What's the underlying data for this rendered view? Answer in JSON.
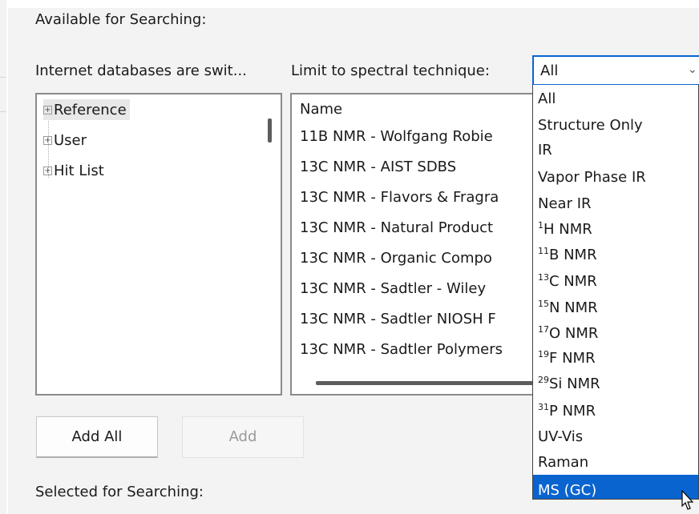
{
  "sections": {
    "available_label": "Available for Searching:",
    "selected_label": "Selected for Searching:"
  },
  "internet_note": "Internet databases are swit...",
  "limit": {
    "label": "Limit to spectral technique:",
    "selected": "All"
  },
  "tree": {
    "items": [
      {
        "label": "Reference",
        "expander": "+"
      },
      {
        "label": "User",
        "expander": "+"
      },
      {
        "label": "Hit List",
        "expander": "+"
      }
    ]
  },
  "list": {
    "header": "Name",
    "rows": [
      "11B NMR - Wolfgang Robie",
      "13C NMR - AIST SDBS",
      "13C NMR - Flavors & Fragra",
      "13C NMR - Natural Product",
      "13C NMR - Organic Compo",
      "13C NMR - Sadtler - Wiley",
      "13C NMR - Sadtler NIOSH F",
      "13C NMR - Sadtler Polymers"
    ]
  },
  "buttons": {
    "add_all": "Add All",
    "add": "Add"
  },
  "dropdown": {
    "options": [
      {
        "sup": "",
        "text": "All"
      },
      {
        "sup": "",
        "text": "Structure Only"
      },
      {
        "sup": "",
        "text": "IR"
      },
      {
        "sup": "",
        "text": "Vapor Phase IR"
      },
      {
        "sup": "",
        "text": "Near IR"
      },
      {
        "sup": "1",
        "text": "H NMR"
      },
      {
        "sup": "11",
        "text": "B NMR"
      },
      {
        "sup": "13",
        "text": "C NMR"
      },
      {
        "sup": "15",
        "text": "N NMR"
      },
      {
        "sup": "17",
        "text": "O NMR"
      },
      {
        "sup": "19",
        "text": "F NMR"
      },
      {
        "sup": "29",
        "text": "Si NMR"
      },
      {
        "sup": "31",
        "text": "P NMR"
      },
      {
        "sup": "",
        "text": "UV-Vis"
      },
      {
        "sup": "",
        "text": "Raman"
      },
      {
        "sup": "",
        "text": "MS (GC)"
      }
    ],
    "highlighted": "MS (GC)"
  },
  "colors": {
    "accent": "#0a64d0",
    "panel": "#f3f3f3"
  },
  "icons": {
    "expander": "plus-box-icon",
    "combo_arrow": "chevron-down-icon",
    "cursor": "mouse-pointer-icon"
  }
}
